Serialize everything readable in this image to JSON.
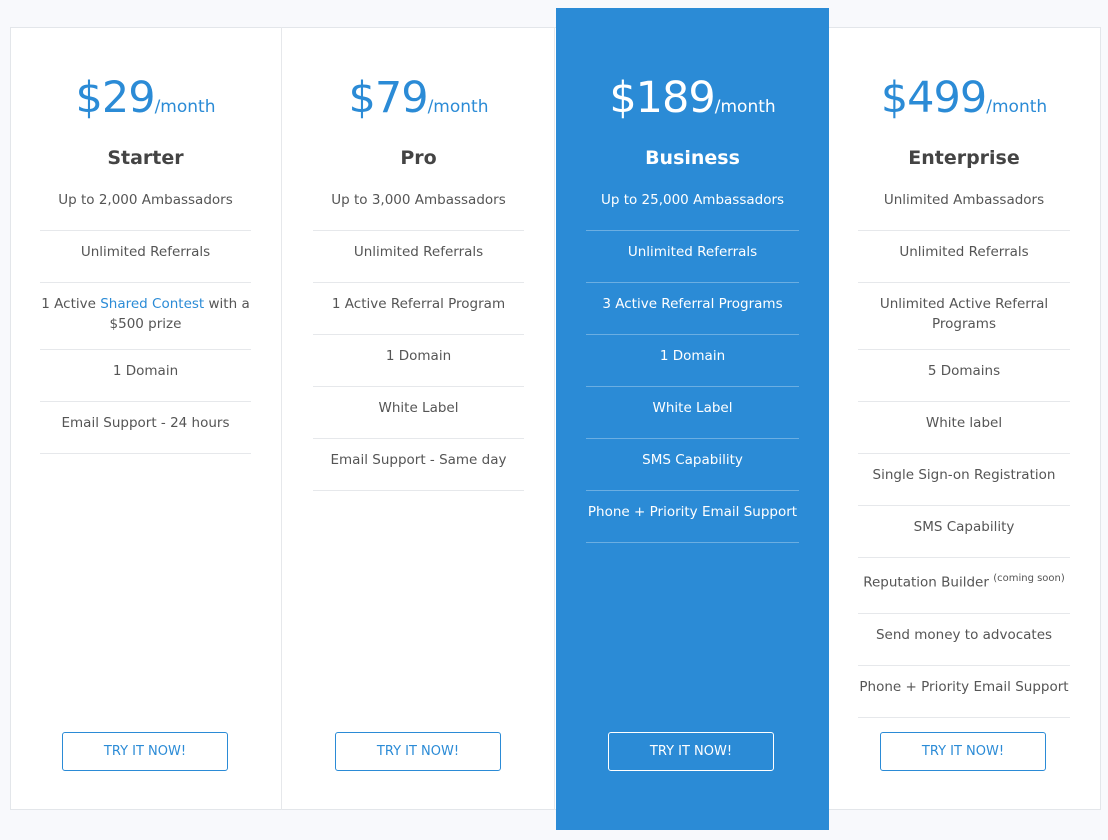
{
  "theme": {
    "accent": "#2b8bd6",
    "featured_bg": "#2b8bd6"
  },
  "plans": [
    {
      "price": "$29",
      "period": "/month",
      "name": "Starter",
      "features": [
        {
          "text": "Up to 2,000 Ambassadors"
        },
        {
          "text": "Unlimited Referrals"
        },
        {
          "pre": "1 Active ",
          "link": "Shared Contest",
          "post": " with a $500 prize"
        },
        {
          "text": "1 Domain"
        },
        {
          "text": "Email Support - 24 hours"
        }
      ],
      "cta": "TRY IT NOW!"
    },
    {
      "price": "$79",
      "period": "/month",
      "name": "Pro",
      "features": [
        {
          "text": "Up to 3,000 Ambassadors"
        },
        {
          "text": "Unlimited Referrals"
        },
        {
          "text": "1 Active Referral Program"
        },
        {
          "text": "1 Domain"
        },
        {
          "text": "White Label"
        },
        {
          "text": "Email Support - Same day"
        }
      ],
      "cta": "TRY IT NOW!"
    },
    {
      "price": "$189",
      "period": "/month",
      "name": "Business",
      "featured": true,
      "features": [
        {
          "text": "Up to 25,000 Ambassadors"
        },
        {
          "text": "Unlimited Referrals"
        },
        {
          "text": "3 Active Referral Programs"
        },
        {
          "text": "1 Domain"
        },
        {
          "text": "White Label"
        },
        {
          "text": "SMS Capability"
        },
        {
          "text": "Phone + Priority Email Support"
        }
      ],
      "cta": "TRY IT NOW!"
    },
    {
      "price": "$499",
      "period": "/month",
      "name": "Enterprise",
      "features": [
        {
          "text": "Unlimited Ambassadors"
        },
        {
          "text": "Unlimited Referrals"
        },
        {
          "text": "Unlimited Active Referral Programs"
        },
        {
          "text": "5 Domains"
        },
        {
          "text": "White label"
        },
        {
          "text": "Single Sign-on Registration"
        },
        {
          "text": "SMS Capability"
        },
        {
          "text": "Reputation Builder",
          "sup": "(coming soon)"
        },
        {
          "text": "Send money to advocates"
        },
        {
          "text": "Phone + Priority Email Support"
        }
      ],
      "cta": "TRY IT NOW!"
    }
  ]
}
